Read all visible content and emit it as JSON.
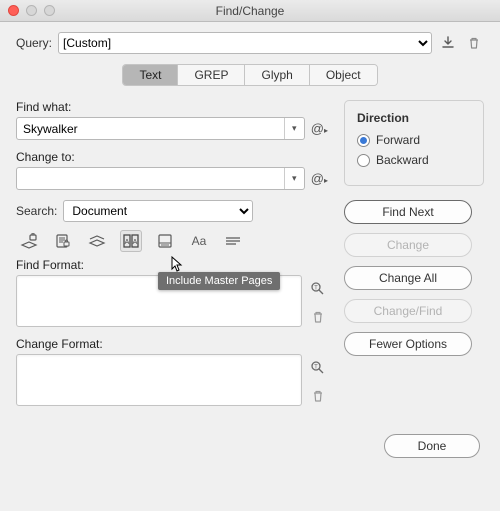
{
  "window": {
    "title": "Find/Change"
  },
  "query": {
    "label": "Query:",
    "selected": "[Custom]"
  },
  "tabs": [
    {
      "label": "Text",
      "active": true
    },
    {
      "label": "GREP",
      "active": false
    },
    {
      "label": "Glyph",
      "active": false
    },
    {
      "label": "Object",
      "active": false
    }
  ],
  "find": {
    "label": "Find what:",
    "value": "Skywalker"
  },
  "change": {
    "label": "Change to:",
    "value": ""
  },
  "search": {
    "label": "Search:",
    "selected": "Document"
  },
  "option_icons": [
    {
      "name": "locked-layers-icon"
    },
    {
      "name": "locked-stories-icon"
    },
    {
      "name": "hidden-layers-icon"
    },
    {
      "name": "master-pages-icon",
      "toggled": true
    },
    {
      "name": "footnotes-icon"
    },
    {
      "name": "case-sensitive-icon",
      "text": "Aa"
    },
    {
      "name": "whole-word-icon"
    }
  ],
  "find_format": {
    "label": "Find Format:"
  },
  "change_format": {
    "label": "Change Format:"
  },
  "direction": {
    "legend": "Direction",
    "forward": "Forward",
    "backward": "Backward",
    "selected": "forward"
  },
  "buttons": {
    "find_next": "Find Next",
    "change": "Change",
    "change_all": "Change All",
    "change_find": "Change/Find",
    "fewer_options": "Fewer Options",
    "done": "Done"
  },
  "tooltip": "Include Master Pages"
}
